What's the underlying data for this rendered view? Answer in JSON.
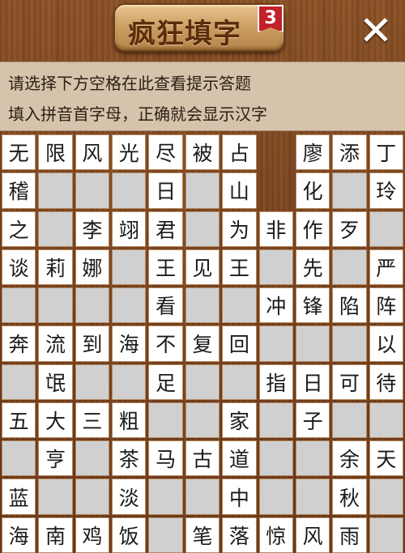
{
  "header": {
    "title": "疯狂填字",
    "level": "3",
    "close_glyph": "✕"
  },
  "hints": {
    "line1": "请选择下方空格在此查看提示答题",
    "line2": "填入拼音首字母，正确就会显示汉字"
  },
  "colors": {
    "wood": "#7a4420",
    "hint_panel": "#d6c3ab",
    "cell_white": "#ffffff",
    "cell_gray": "#d0d0d0",
    "badge": "#c2202a"
  },
  "grid": {
    "rows": [
      [
        "无",
        "限",
        "风",
        "光",
        "尽",
        "被",
        "占",
        "#",
        "廖",
        "添",
        "丁"
      ],
      [
        "稽",
        "_",
        "_",
        "_",
        "日",
        "_",
        "山",
        "#",
        "化",
        "_",
        "玲"
      ],
      [
        "之",
        "_",
        "李",
        "翊",
        "君",
        "_",
        "为",
        "非",
        "作",
        "歹",
        "_"
      ],
      [
        "谈",
        "莉",
        "娜",
        "_",
        "王",
        "见",
        "王",
        "_",
        "先",
        "_",
        "严"
      ],
      [
        "_",
        "_",
        "_",
        "_",
        "看",
        "_",
        "_",
        "冲",
        "锋",
        "陷",
        "阵"
      ],
      [
        "奔",
        "流",
        "到",
        "海",
        "不",
        "复",
        "回",
        "_",
        "_",
        "_",
        "以"
      ],
      [
        "_",
        "氓",
        "_",
        "_",
        "足",
        "_",
        "_",
        "指",
        "日",
        "可",
        "待"
      ],
      [
        "五",
        "大",
        "三",
        "粗",
        "_",
        "_",
        "家",
        "_",
        "子",
        "_",
        "_"
      ],
      [
        "_",
        "亨",
        "_",
        "茶",
        "马",
        "古",
        "道",
        "_",
        "_",
        "余",
        "天"
      ],
      [
        "蓝",
        "_",
        "_",
        "淡",
        "_",
        "_",
        "中",
        "_",
        "_",
        "秋",
        "_"
      ],
      [
        "海",
        "南",
        "鸡",
        "饭",
        "_",
        "笔",
        "落",
        "惊",
        "风",
        "雨",
        "_"
      ]
    ]
  }
}
